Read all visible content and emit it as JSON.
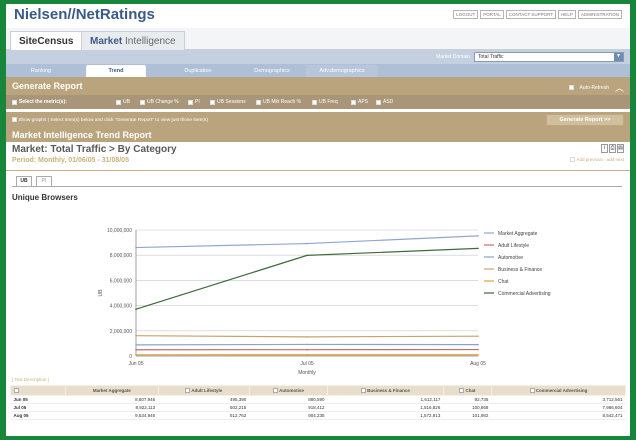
{
  "header": {
    "brand": "Nielsen//NetRatings",
    "links": [
      "LOGOUT",
      "PORTAL",
      "CONTACT SUPPORT",
      "HELP",
      "ADMINISTRATION"
    ]
  },
  "product_tabs": {
    "sitecensus": "SiteCensus",
    "mi_prefix": "Market",
    "mi_suffix": " Intelligence"
  },
  "market_domain": {
    "label": "Market Domain",
    "value": "Total Traffic"
  },
  "nav": [
    "Ranking",
    "Trend",
    "Duplication",
    "Demographics",
    "Adv.demographics"
  ],
  "nav_active": 1,
  "generate": {
    "title": "Generate Report",
    "toggle_label": "Auto-Refresh",
    "metrics_label": "Select the metric(s):",
    "metrics": [
      "UB",
      "UB Change %",
      "PI",
      "UB Sessions",
      "UB Mkt Reach %",
      "UB Freq",
      "APS",
      "ASD"
    ],
    "show_graphs": "Show graphs | Select item(s) below and click \"Generate Report\" to view just those item(s)",
    "button": "Generate Report >>"
  },
  "report": {
    "section_title": "Market Intelligence Trend Report",
    "title": "Market: Total Traffic > By Category",
    "period": "Period: Monthly, 01/06/05 - 31/08/05",
    "links": "Add previous - add next",
    "subtabs": [
      "UB",
      "PI"
    ],
    "chart_title": "Unique Browsers",
    "table_desc": "[ Text Description ]"
  },
  "chart_data": {
    "type": "line",
    "title": "Unique Browsers",
    "xlabel": "Monthly",
    "ylabel": "UB",
    "categories": [
      "Jun 05",
      "Jul 05",
      "Aug 05"
    ],
    "ylim": [
      0,
      10000000
    ],
    "yticks": [
      "0",
      "2,000,000",
      "4,000,000",
      "6,000,000",
      "8,000,000",
      "10,000,000"
    ],
    "grid": true,
    "legend_position": "right",
    "series": [
      {
        "name": "Market Aggregate",
        "color": "#8fa7cf",
        "values": [
          8607946,
          8922113,
          9534946
        ]
      },
      {
        "name": "Adult Lifestyle",
        "color": "#c86a6a",
        "values": [
          495390,
          502215,
          512762
        ]
      },
      {
        "name": "Automotive",
        "color": "#8aa4c8",
        "values": [
          880590,
          918412,
          904235
        ]
      },
      {
        "name": "Business & Finance",
        "color": "#c7a46f",
        "values": [
          1612117,
          1516826,
          1572913
        ]
      },
      {
        "name": "Chat",
        "color": "#e0a03c",
        "values": [
          92735,
          100868,
          101982
        ]
      },
      {
        "name": "Commercial Advertising",
        "color": "#3f6b3c",
        "values": [
          3712561,
          7986604,
          8542471
        ]
      }
    ]
  },
  "table": {
    "rows": [
      {
        "label": "Jun 05",
        "values": [
          "8,607,946",
          "495,390",
          "880,590",
          "1,612,117",
          "92,735",
          "3,712,561"
        ]
      },
      {
        "label": "Jul 05",
        "values": [
          "8,922,113",
          "502,215",
          "918,412",
          "1,516,826",
          "100,868",
          "7,986,604"
        ]
      },
      {
        "label": "Aug 05",
        "values": [
          "9,534,946",
          "512,762",
          "904,235",
          "1,572,913",
          "101,982",
          "8,542,471"
        ]
      }
    ]
  }
}
